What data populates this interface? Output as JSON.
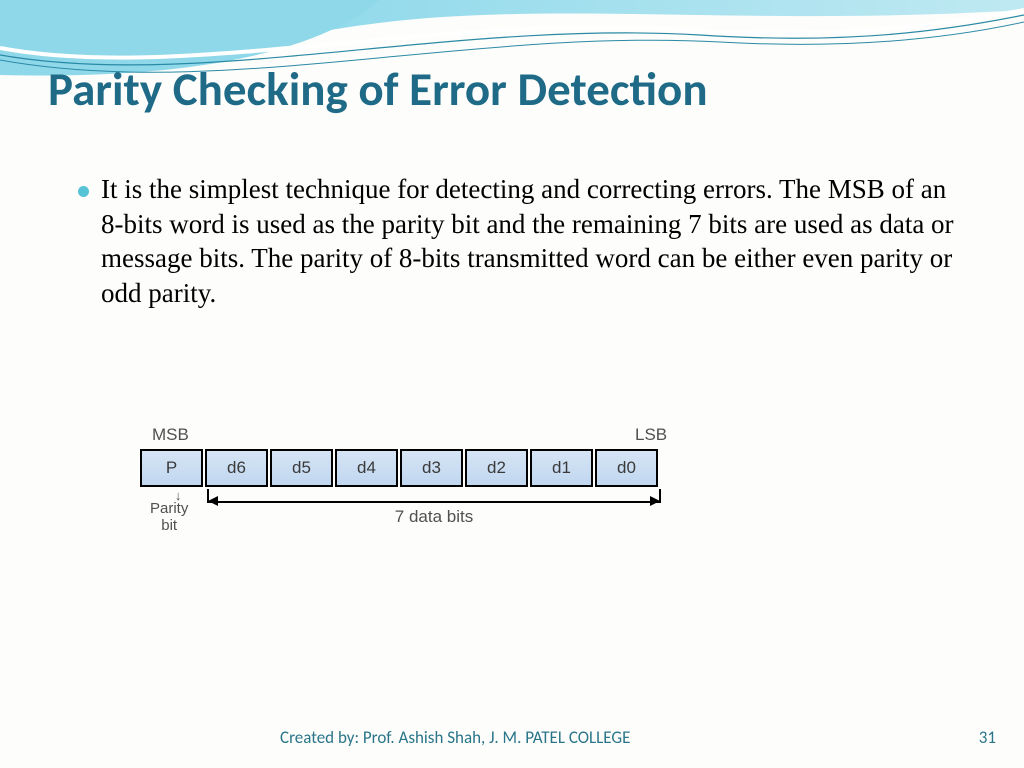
{
  "title": "Parity Checking of Error Detection",
  "body": "It is the simplest technique for detecting and correcting errors. The MSB of an 8-bits word is used as the parity bit and the remaining 7 bits are used as data or message bits. The parity of 8-bits transmitted word can be either even parity or odd parity.",
  "diagram": {
    "msb": "MSB",
    "lsb": "LSB",
    "cells": [
      "P",
      "d6",
      "d5",
      "d4",
      "d3",
      "d2",
      "d1",
      "d0"
    ],
    "parity_label": "Parity\nbit",
    "data_label": "7 data bits"
  },
  "footer": "Created by: Prof. Ashish Shah, J. M. PATEL COLLEGE",
  "page": "31"
}
